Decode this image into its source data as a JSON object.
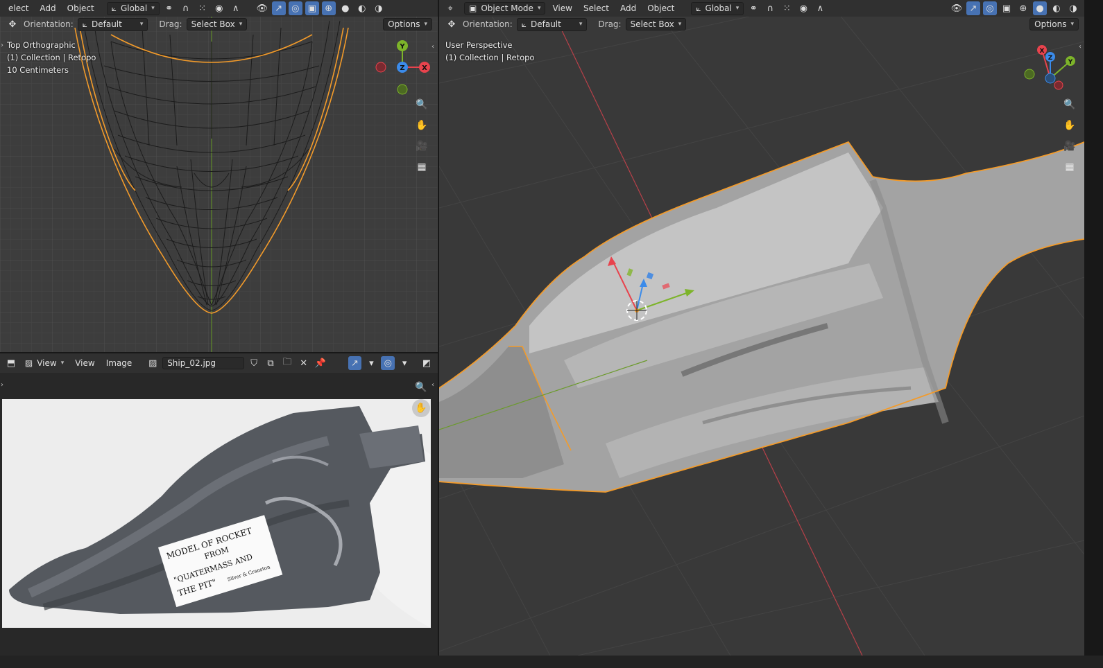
{
  "top_left": {
    "header": {
      "menu_select": "elect",
      "menu_add": "Add",
      "menu_object": "Object",
      "transform_orientation": "Global"
    },
    "toolbar": {
      "orientation_label": "Orientation:",
      "orientation_value": "Default",
      "drag_label": "Drag:",
      "drag_value": "Select Box",
      "options_label": "Options"
    },
    "overlay": {
      "view_name": "Top Orthographic",
      "collection": "(1) Collection | Retopo",
      "scale": "10 Centimeters"
    },
    "gizmo": {
      "x": "X",
      "y": "Y",
      "z": "Z"
    }
  },
  "image_editor": {
    "header": {
      "view_menu": "View",
      "view_menu2": "View",
      "image_menu": "Image",
      "image_name": "Ship_02.jpg"
    },
    "photo_label_text": [
      "MODEL OF ROCKET",
      "FROM",
      "\"QUATERMASS AND",
      "THE PIT\"",
      "Silver & Cranston"
    ]
  },
  "right": {
    "header": {
      "mode": "Object Mode",
      "menu_view": "View",
      "menu_select": "Select",
      "menu_add": "Add",
      "menu_object": "Object",
      "transform_orientation": "Global"
    },
    "toolbar": {
      "orientation_label": "Orientation:",
      "orientation_value": "Default",
      "drag_label": "Drag:",
      "drag_value": "Select Box",
      "options_label": "Options"
    },
    "overlay": {
      "view_name": "User Perspective",
      "collection": "(1) Collection | Retopo"
    },
    "gizmo": {
      "x": "X",
      "y": "Y",
      "z": "Z"
    }
  },
  "colors": {
    "header_bg": "#303030",
    "viewport_bg": "#3d3d3d",
    "viewport_persp_bg": "#393939",
    "selection_outline": "#f39b2a",
    "axis_x": "#e8434d",
    "axis_y": "#7db42a",
    "axis_z": "#3b8bea",
    "active_button": "#4772b3"
  }
}
